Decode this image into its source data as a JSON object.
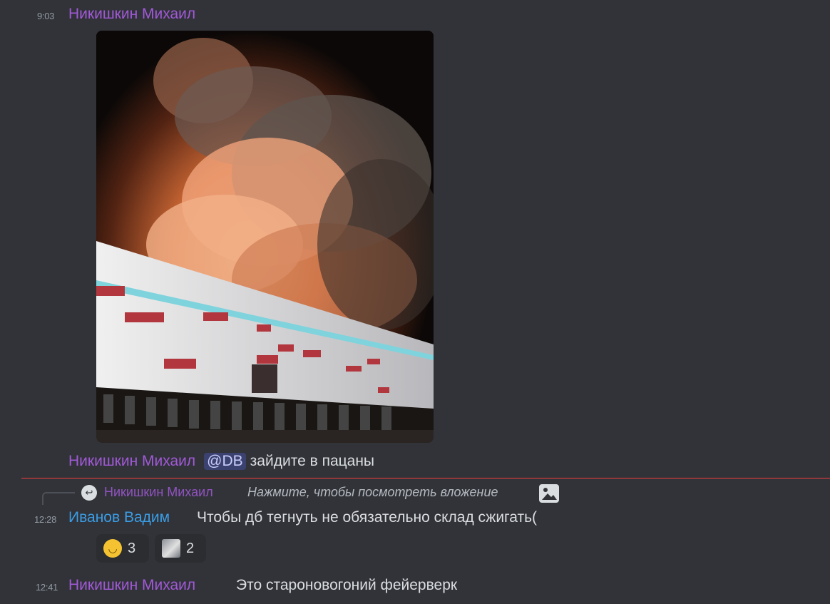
{
  "messages": [
    {
      "time": "9:03",
      "author": "Никишкин Михаил",
      "attachment": {
        "kind": "image",
        "colors": {
          "sky": "#0b0807",
          "fire": "#e5743a",
          "smoke": "#6c5a52",
          "wall": "#dcdcdc",
          "stripe": "#b2363d",
          "windows": "#7fd3dc"
        }
      }
    },
    {
      "author": "Никишкин Михаил",
      "mention": "@DB",
      "text": "зайдите в пацаны"
    },
    {
      "time": "12:28",
      "author": "Иванов Вадим",
      "reply": {
        "author": "Никишкин Михаил",
        "text": "Нажмите, чтобы посмотреть вложение",
        "icon": "image-icon"
      },
      "text": "Чтобы дб тегнуть не обязательно склад сжигать(",
      "reactions": [
        {
          "emoji": "tear-smile-emoji",
          "count": "3"
        },
        {
          "emoji": "cat-sticker",
          "count": "2"
        }
      ]
    },
    {
      "time": "12:41",
      "author": "Никишкин Михаил",
      "text": "Это староновогоний фейерверк"
    }
  ],
  "colors": {
    "background": "#313338",
    "author_purple": "#a259d8",
    "author_blue": "#3b9de6",
    "new_divider": "#f23f43",
    "mention_bg": "#3c4270"
  }
}
